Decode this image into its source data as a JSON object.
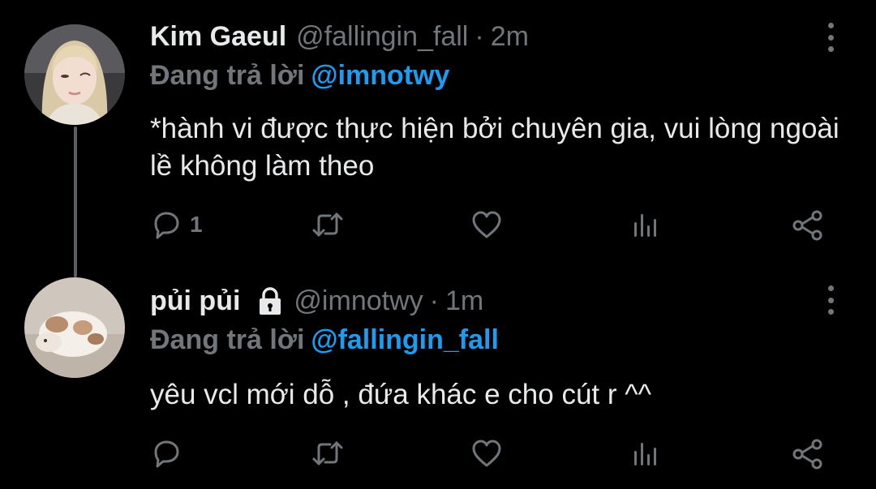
{
  "tweets": [
    {
      "display_name": "Kim Gaeul",
      "handle": "@fallingin_fall",
      "separator": "·",
      "time": "2m",
      "replying_prefix": "Đang trả lời",
      "replying_to": "@imnotwy",
      "text": "*hành vi được thực hiện bởi chuyên gia, vui lòng ngoài lề không làm theo",
      "reply_count": "1",
      "avatar_icon": "avatar-photo-blonde-person",
      "protected": false
    },
    {
      "display_name": "pủi pủi",
      "handle": "@imnotwy",
      "separator": "·",
      "time": "1m",
      "replying_prefix": "Đang trả lời",
      "replying_to": "@fallingin_fall",
      "text": "yêu vcl mới dỗ , đứa khác e cho cút r ^^",
      "reply_count": "",
      "avatar_icon": "avatar-photo-rabbit",
      "protected": true
    }
  ],
  "icons": {
    "reply": "reply-icon",
    "retweet": "retweet-icon",
    "like": "heart-icon",
    "views": "views-icon",
    "share": "share-icon",
    "more": "more-vertical-icon",
    "lock": "lock-icon"
  },
  "colors": {
    "background": "#000000",
    "text": "#e7e9ea",
    "muted": "#71767b",
    "accent": "#1d9bf0",
    "thread_line": "#5b5f63"
  }
}
